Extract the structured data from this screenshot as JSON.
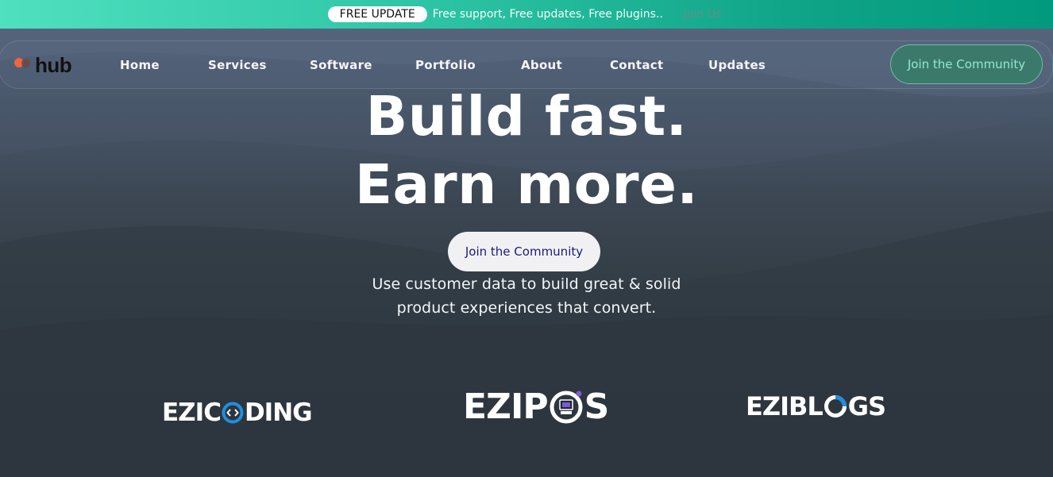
{
  "banner": {
    "badge": "FREE UPDATE",
    "text": "Free support, Free updates, Free plugins..",
    "link": "Join Us"
  },
  "logo": {
    "text": "hub"
  },
  "nav": {
    "items": [
      "Home",
      "Services",
      "Software",
      "Portfolio",
      "About",
      "Contact",
      "Updates"
    ],
    "cta": "Join the Community"
  },
  "hero": {
    "line1": "Build fast.",
    "line2": "Earn more.",
    "cta": "Join the Community",
    "sub1": "Use customer data to build great & solid",
    "sub2": "product experiences that convert."
  },
  "brands": {
    "b1": {
      "left": "EZIC",
      "right": "DING"
    },
    "b2": {
      "left": "EZIP",
      "right": "S"
    },
    "b3": {
      "left": "EZIBL",
      "right": "GS"
    }
  },
  "colors": {
    "accent": "#10a488",
    "banner_start": "#4fe0bf",
    "banner_end": "#019a7e",
    "logo_dot": "#f0653e",
    "brand_blue": "#1e8fe0"
  }
}
